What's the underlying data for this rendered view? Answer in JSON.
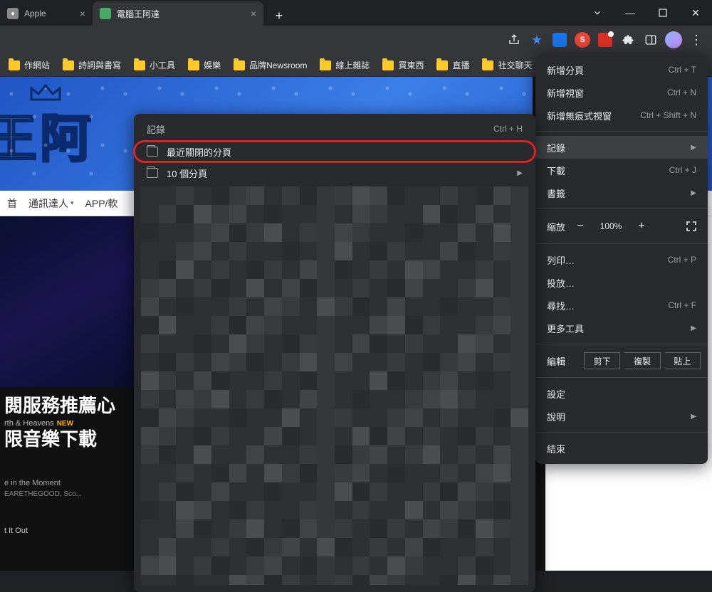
{
  "tabs": {
    "t0": "Apple",
    "t1": "電腦王阿達"
  },
  "window_controls": {
    "min": "—",
    "max": "▢",
    "close": "✕"
  },
  "toolbar": {
    "share": "share-icon",
    "star": "★"
  },
  "bookmarks": [
    "作網站",
    "詩詞與書寫",
    "小工具",
    "娛樂",
    "品牌Newsroom",
    "線上雜誌",
    "買東西",
    "直播",
    "社交聊天"
  ],
  "page": {
    "hero_title": "王阿",
    "nav": {
      "n0": "首",
      "n1": "通訊達人",
      "n2": "APP/軟"
    },
    "art_h1": "閱服務推薦心",
    "art_sub": "rth & Heavens",
    "art_new": "NEW",
    "art_h2": "限音樂下載",
    "meta1": "e in the Moment",
    "meta2": "EARETHEGOOD, Sco...",
    "bottom": "t It Out"
  },
  "history_menu": {
    "title": "記錄",
    "shortcut": "Ctrl + H",
    "recent": "最近關閉的分頁",
    "count": "10 個分頁"
  },
  "main_menu": {
    "new_tab": "新增分頁",
    "new_tab_sc": "Ctrl + T",
    "new_window": "新增視窗",
    "new_window_sc": "Ctrl + N",
    "incognito": "新增無痕式視窗",
    "incognito_sc": "Ctrl + Shift + N",
    "history": "記錄",
    "downloads": "下載",
    "downloads_sc": "Ctrl + J",
    "bookmarks": "書籤",
    "zoom_lbl": "縮放",
    "zoom_val": "100%",
    "print": "列印…",
    "print_sc": "Ctrl + P",
    "cast": "投放…",
    "find": "尋找…",
    "find_sc": "Ctrl + F",
    "more_tools": "更多工具",
    "edit_lbl": "編輯",
    "cut": "剪下",
    "copy": "複製",
    "paste": "貼上",
    "settings": "設定",
    "help": "說明",
    "exit": "結束"
  }
}
